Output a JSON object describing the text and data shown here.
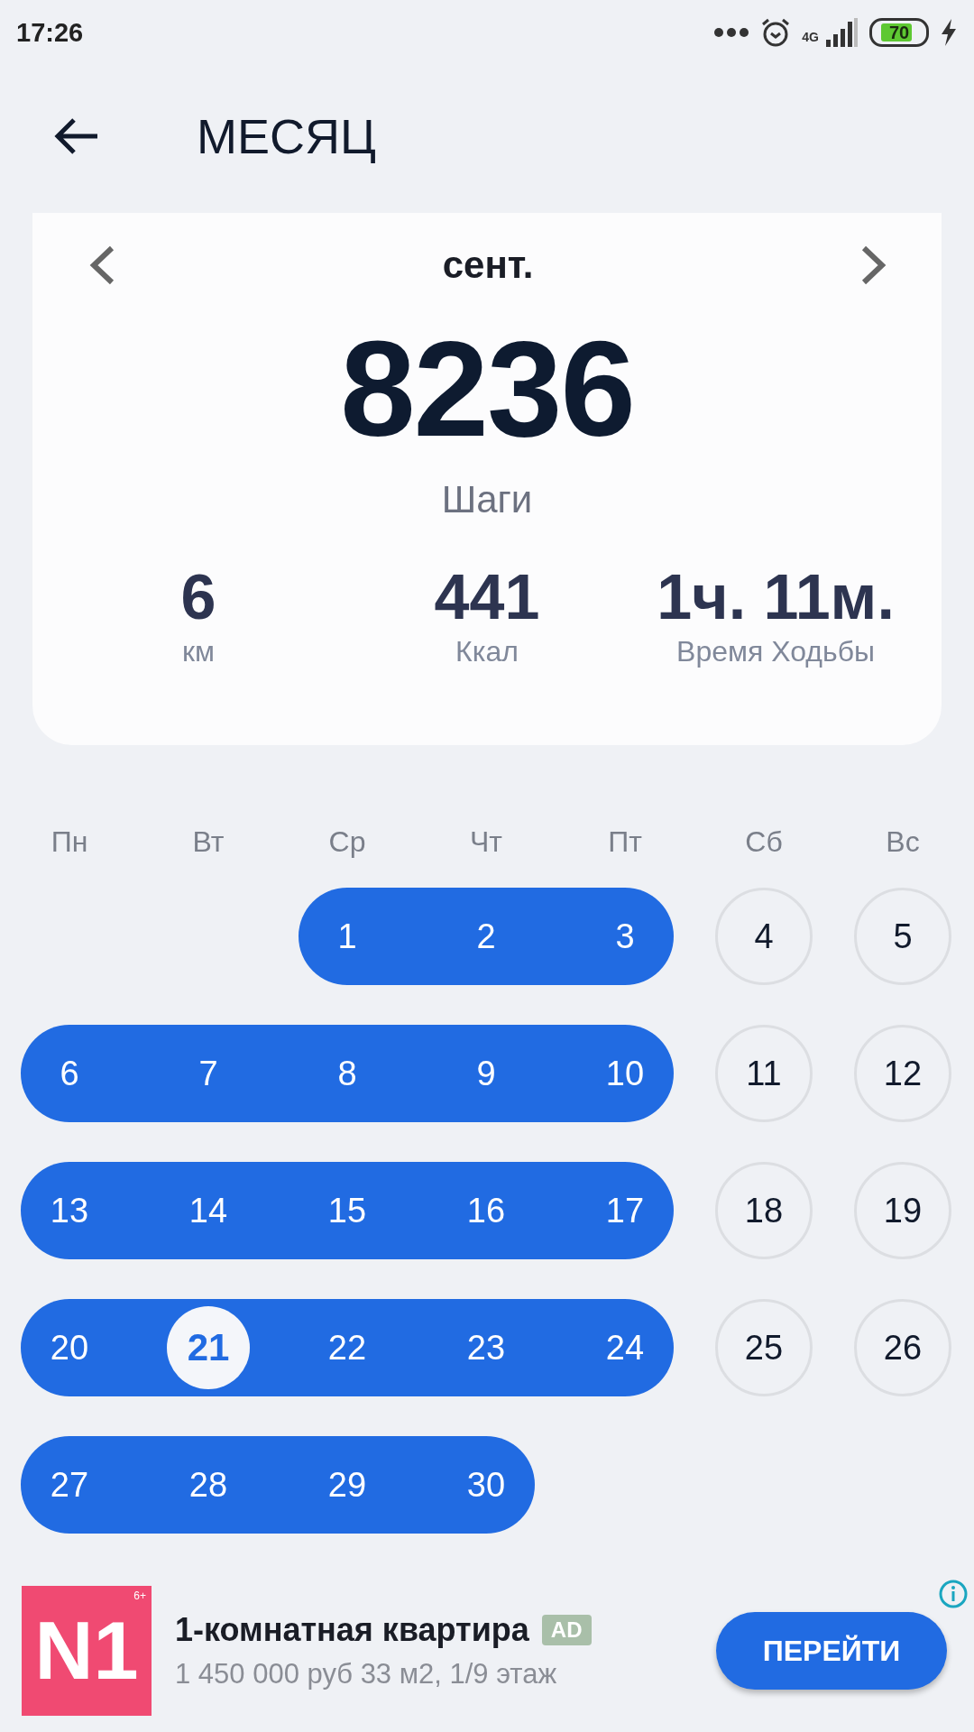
{
  "status_bar": {
    "time": "17:26",
    "network": "4G",
    "battery": "70"
  },
  "header": {
    "title": "МЕСЯЦ"
  },
  "summary": {
    "month": "сент.",
    "steps": "8236",
    "steps_label": "Шаги",
    "stats": [
      {
        "value": "6",
        "label": "км"
      },
      {
        "value": "441",
        "label": "Ккал"
      },
      {
        "value": "1ч. 11м.",
        "label": "Время Ходьбы"
      }
    ]
  },
  "calendar": {
    "weekdays": [
      "Пн",
      "Вт",
      "Ср",
      "Чт",
      "Пт",
      "Сб",
      "Вс"
    ],
    "weeks": [
      [
        {
          "kind": "blank"
        },
        {
          "kind": "blank"
        },
        {
          "kind": "day",
          "day": "1",
          "reached": true,
          "selected": false
        },
        {
          "kind": "day",
          "day": "2",
          "reached": true,
          "selected": false
        },
        {
          "kind": "day",
          "day": "3",
          "reached": true,
          "selected": false
        },
        {
          "kind": "day",
          "day": "4",
          "reached": false,
          "selected": false
        },
        {
          "kind": "day",
          "day": "5",
          "reached": false,
          "selected": false
        }
      ],
      [
        {
          "kind": "day",
          "day": "6",
          "reached": true,
          "selected": false
        },
        {
          "kind": "day",
          "day": "7",
          "reached": true,
          "selected": false
        },
        {
          "kind": "day",
          "day": "8",
          "reached": true,
          "selected": false
        },
        {
          "kind": "day",
          "day": "9",
          "reached": true,
          "selected": false
        },
        {
          "kind": "day",
          "day": "10",
          "reached": true,
          "selected": false
        },
        {
          "kind": "day",
          "day": "11",
          "reached": false,
          "selected": false
        },
        {
          "kind": "day",
          "day": "12",
          "reached": false,
          "selected": false
        }
      ],
      [
        {
          "kind": "day",
          "day": "13",
          "reached": true,
          "selected": false
        },
        {
          "kind": "day",
          "day": "14",
          "reached": true,
          "selected": false
        },
        {
          "kind": "day",
          "day": "15",
          "reached": true,
          "selected": false
        },
        {
          "kind": "day",
          "day": "16",
          "reached": true,
          "selected": false
        },
        {
          "kind": "day",
          "day": "17",
          "reached": true,
          "selected": false
        },
        {
          "kind": "day",
          "day": "18",
          "reached": false,
          "selected": false
        },
        {
          "kind": "day",
          "day": "19",
          "reached": false,
          "selected": false
        }
      ],
      [
        {
          "kind": "day",
          "day": "20",
          "reached": true,
          "selected": false
        },
        {
          "kind": "day",
          "day": "21",
          "reached": true,
          "selected": true
        },
        {
          "kind": "day",
          "day": "22",
          "reached": true,
          "selected": false
        },
        {
          "kind": "day",
          "day": "23",
          "reached": true,
          "selected": false
        },
        {
          "kind": "day",
          "day": "24",
          "reached": true,
          "selected": false
        },
        {
          "kind": "day",
          "day": "25",
          "reached": false,
          "selected": false
        },
        {
          "kind": "day",
          "day": "26",
          "reached": false,
          "selected": false
        }
      ],
      [
        {
          "kind": "day",
          "day": "27",
          "reached": true,
          "selected": false
        },
        {
          "kind": "day",
          "day": "28",
          "reached": true,
          "selected": false
        },
        {
          "kind": "day",
          "day": "29",
          "reached": true,
          "selected": false
        },
        {
          "kind": "day",
          "day": "30",
          "reached": true,
          "selected": false
        }
      ]
    ]
  },
  "ad": {
    "logo": "N1",
    "age_rating": "6+",
    "title": "1-комнатная квартира",
    "badge": "AD",
    "description": "1 450 000 руб 33 м2, 1/9 этаж",
    "button": "ПЕРЕЙТИ"
  }
}
